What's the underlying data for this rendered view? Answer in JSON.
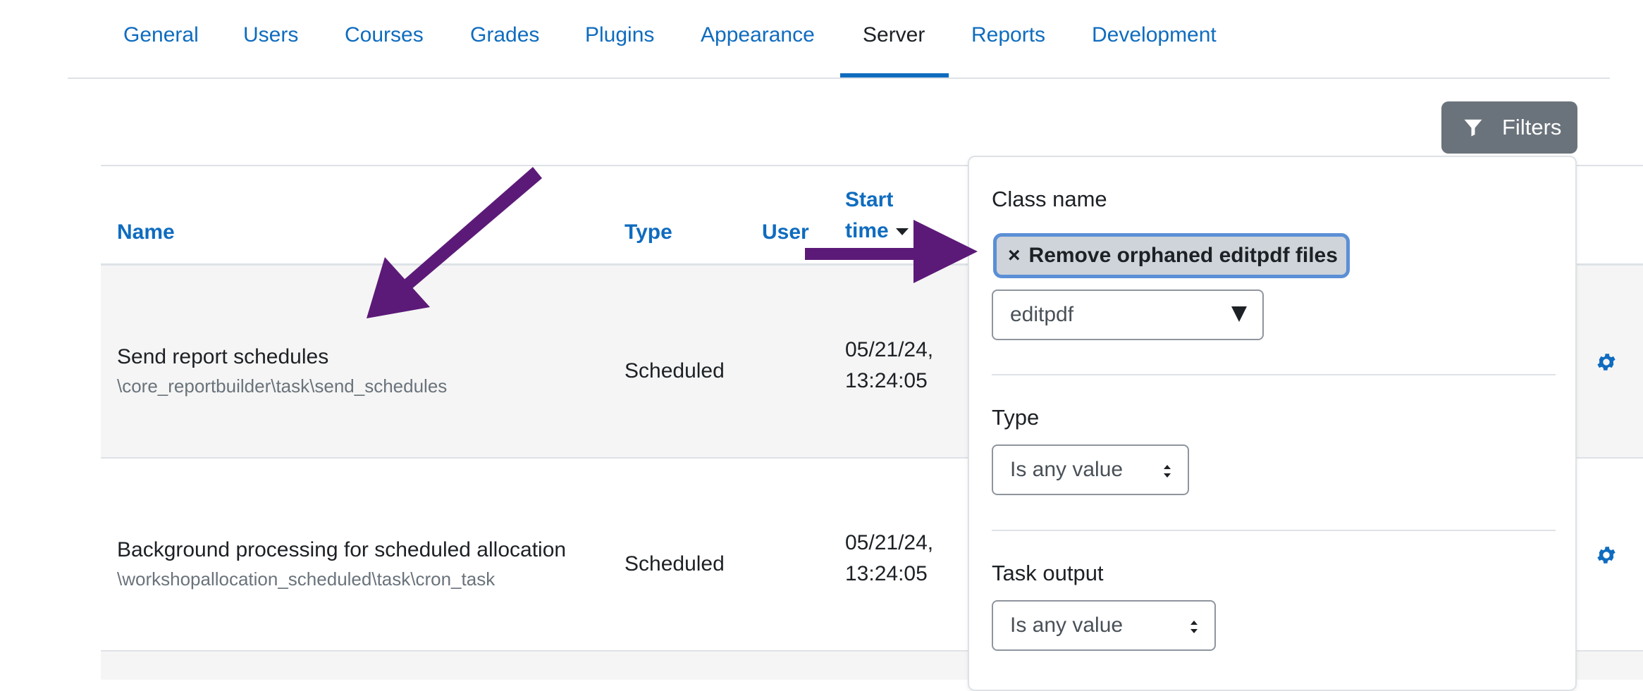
{
  "nav": {
    "tabs": [
      {
        "label": "General"
      },
      {
        "label": "Users"
      },
      {
        "label": "Courses"
      },
      {
        "label": "Grades"
      },
      {
        "label": "Plugins"
      },
      {
        "label": "Appearance"
      },
      {
        "label": "Server"
      },
      {
        "label": "Reports"
      },
      {
        "label": "Development"
      }
    ],
    "active": "Server"
  },
  "filters_button": {
    "label": "Filters"
  },
  "table": {
    "headers": {
      "name": "Name",
      "type": "Type",
      "user": "User",
      "start_time_1": "Start",
      "start_time_2": "time"
    },
    "rows": [
      {
        "name": "Send report schedules",
        "class": "\\core_reportbuilder\\task\\send_schedules",
        "type": "Scheduled",
        "date": "05/21/24,",
        "time": "13:24:05"
      },
      {
        "name": "Background processing for scheduled allocation",
        "class": "\\workshopallocation_scheduled\\task\\cron_task",
        "type": "Scheduled",
        "date": "05/21/24,",
        "time": "13:24:05"
      }
    ]
  },
  "filter_panel": {
    "class_name": {
      "label": "Class name",
      "chip_remove": "×",
      "chip_label": "Remove orphaned editpdf files",
      "search_value": "editpdf"
    },
    "type": {
      "label": "Type",
      "value": "Is any value"
    },
    "task_output": {
      "label": "Task output",
      "value": "Is any value"
    }
  },
  "colors": {
    "link": "#0f6cbf",
    "annotation_arrow": "#5c1a78",
    "chip_border": "#5b8fd6",
    "filters_button_bg": "#6a737b"
  }
}
